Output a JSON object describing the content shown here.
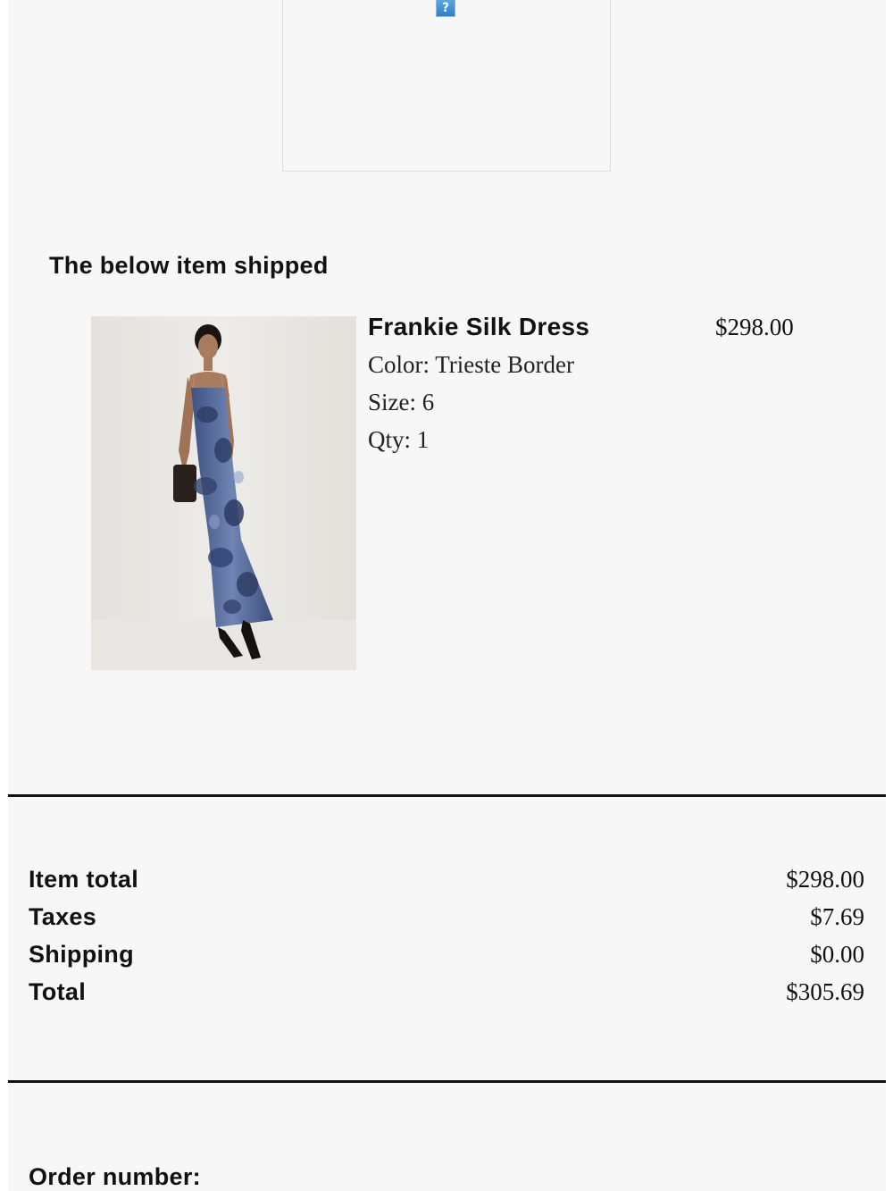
{
  "header_image": {
    "icon": "broken-image-icon",
    "glyph": "?"
  },
  "shipment": {
    "heading": "The below item shipped",
    "item": {
      "image_icon": "product-photo",
      "name": "Frankie Silk Dress",
      "price": "$298.00",
      "color_line": "Color: Trieste Border",
      "size_line": "Size: 6",
      "qty_line": "Qty: 1"
    }
  },
  "summary": {
    "rows": [
      {
        "label": "Item total",
        "value": "$298.00"
      },
      {
        "label": "Taxes",
        "value": "$7.69"
      },
      {
        "label": "Shipping",
        "value": "$0.00"
      },
      {
        "label": "Total",
        "value": "$305.69"
      }
    ]
  },
  "order": {
    "label": "Order number:"
  },
  "colors": {
    "page_background": "#f7f7f7",
    "text": "#111111",
    "divider": "#111111",
    "dress_blue": "#5b6f9c"
  }
}
